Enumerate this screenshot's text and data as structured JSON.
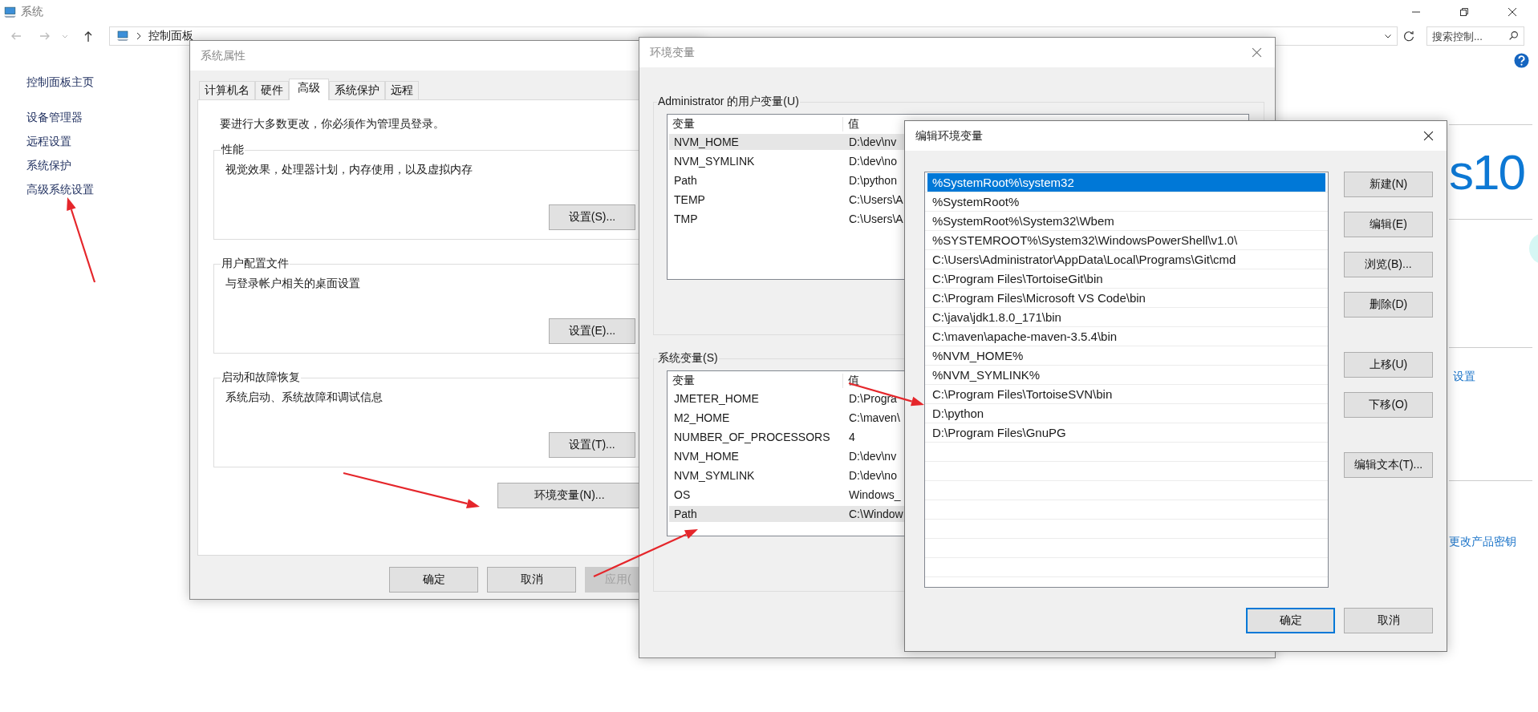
{
  "main_window": {
    "title": "系统",
    "breadcrumb": [
      "控制面板"
    ],
    "search": {
      "placeholder": "搜索控制..."
    },
    "sidebar": {
      "items": [
        {
          "label": "控制面板主页"
        },
        {
          "label": "设备管理器"
        },
        {
          "label": "远程设置"
        },
        {
          "label": "系统保护"
        },
        {
          "label": "高级系统设置"
        }
      ]
    },
    "logo_text": "s10",
    "links": [
      "设置",
      "更改产品密钥"
    ]
  },
  "system_properties": {
    "title": "系统属性",
    "tabs": [
      {
        "label": "计算机名",
        "selected": false
      },
      {
        "label": "硬件",
        "selected": false
      },
      {
        "label": "高级",
        "selected": true
      },
      {
        "label": "系统保护",
        "selected": false
      },
      {
        "label": "远程",
        "selected": false
      }
    ],
    "notice": "要进行大多数更改，你必须作为管理员登录。",
    "groups": [
      {
        "title": "性能",
        "description": "视觉效果，处理器计划，内存使用，以及虚拟内存",
        "button": "设置(S)..."
      },
      {
        "title": "用户配置文件",
        "description": "与登录帐户相关的桌面设置",
        "button": "设置(E)..."
      },
      {
        "title": "启动和故障恢复",
        "description": "系统启动、系统故障和调试信息",
        "button": "设置(T)..."
      }
    ],
    "env_button": "环境变量(N)...",
    "buttons": [
      {
        "label": "确定",
        "disabled": false
      },
      {
        "label": "取消",
        "disabled": false
      },
      {
        "label": "应用(",
        "disabled": true
      }
    ]
  },
  "env_vars": {
    "title": "环境变量",
    "user_group": {
      "title": "Administrator 的用户变量(U)",
      "columns": [
        "变量",
        "值"
      ],
      "rows": [
        {
          "name": "NVM_HOME",
          "value": "D:\\dev\\nv",
          "selected": true
        },
        {
          "name": "NVM_SYMLINK",
          "value": "D:\\dev\\no",
          "selected": false
        },
        {
          "name": "Path",
          "value": "D:\\python",
          "selected": false
        },
        {
          "name": "TEMP",
          "value": "C:\\Users\\A",
          "selected": false
        },
        {
          "name": "TMP",
          "value": "C:\\Users\\A",
          "selected": false
        }
      ]
    },
    "system_group": {
      "title": "系统变量(S)",
      "columns": [
        "变量",
        "值"
      ],
      "rows": [
        {
          "name": "JMETER_HOME",
          "value": "D:\\Progra",
          "selected": false
        },
        {
          "name": "M2_HOME",
          "value": "C:\\maven\\",
          "selected": false
        },
        {
          "name": "NUMBER_OF_PROCESSORS",
          "value": "4",
          "selected": false
        },
        {
          "name": "NVM_HOME",
          "value": "D:\\dev\\nv",
          "selected": false
        },
        {
          "name": "NVM_SYMLINK",
          "value": "D:\\dev\\no",
          "selected": false
        },
        {
          "name": "OS",
          "value": "Windows_",
          "selected": false
        },
        {
          "name": "Path",
          "value": "C:\\Window",
          "selected": true
        }
      ]
    }
  },
  "edit_env": {
    "title": "编辑环境变量",
    "entries": [
      {
        "text": "%SystemRoot%\\system32",
        "selected": true
      },
      {
        "text": "%SystemRoot%",
        "selected": false
      },
      {
        "text": "%SystemRoot%\\System32\\Wbem",
        "selected": false
      },
      {
        "text": "%SYSTEMROOT%\\System32\\WindowsPowerShell\\v1.0\\",
        "selected": false
      },
      {
        "text": "C:\\Users\\Administrator\\AppData\\Local\\Programs\\Git\\cmd",
        "selected": false
      },
      {
        "text": "C:\\Program Files\\TortoiseGit\\bin",
        "selected": false
      },
      {
        "text": "C:\\Program Files\\Microsoft VS Code\\bin",
        "selected": false
      },
      {
        "text": "C:\\java\\jdk1.8.0_171\\bin",
        "selected": false
      },
      {
        "text": "C:\\maven\\apache-maven-3.5.4\\bin",
        "selected": false
      },
      {
        "text": "%NVM_HOME%",
        "selected": false
      },
      {
        "text": "%NVM_SYMLINK%",
        "selected": false
      },
      {
        "text": "C:\\Program Files\\TortoiseSVN\\bin",
        "selected": false
      },
      {
        "text": "D:\\python",
        "selected": false
      },
      {
        "text": "D:\\Program Files\\GnuPG",
        "selected": false
      }
    ],
    "side_button_groups": [
      [
        "新建(N)",
        "编辑(E)",
        "浏览(B)...",
        "删除(D)"
      ],
      [
        "上移(U)",
        "下移(O)"
      ],
      [
        "编辑文本(T)..."
      ]
    ],
    "buttons": [
      {
        "label": "确定",
        "default": true
      },
      {
        "label": "取消",
        "default": false
      }
    ]
  }
}
